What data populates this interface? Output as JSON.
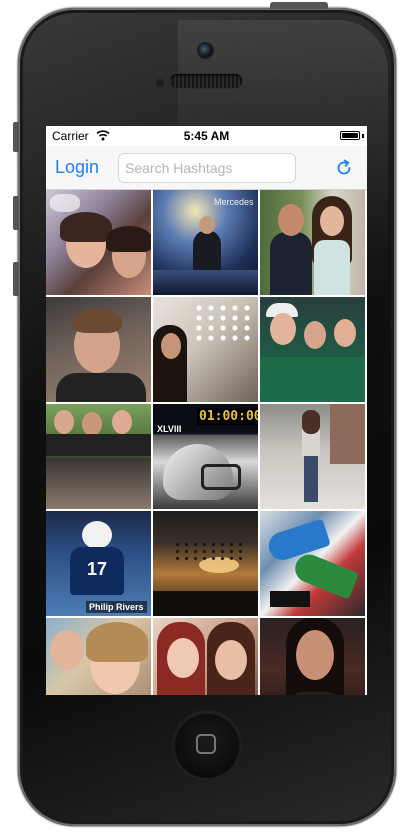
{
  "status_bar": {
    "carrier": "Carrier",
    "time": "5:45 AM",
    "wifi_icon": "wifi-icon",
    "battery_icon": "battery-icon",
    "battery_level": 1.0
  },
  "nav": {
    "login_label": "Login",
    "search_placeholder": "Search Hashtags",
    "search_value": "",
    "refresh_icon": "refresh-icon"
  },
  "colors": {
    "accent": "#1f7ff5",
    "navbar_bg": "#f7f7f8",
    "placeholder": "#b5b5ba"
  },
  "grid": {
    "columns": 3,
    "tiles": [
      {
        "subject": "party-selfie"
      },
      {
        "subject": "stage-performer",
        "text": "Mercedes"
      },
      {
        "subject": "couple-portrait"
      },
      {
        "subject": "boy-selfie"
      },
      {
        "subject": "girl-wall-lights"
      },
      {
        "subject": "friends-group"
      },
      {
        "subject": "guys-group"
      },
      {
        "subject": "countdown-football",
        "text": "01:00:00",
        "badge": "XLVIII"
      },
      {
        "subject": "girl-street"
      },
      {
        "subject": "football-player",
        "jersey": "17",
        "caption": "Philip Rivers"
      },
      {
        "subject": "sunset-birds"
      },
      {
        "subject": "graffiti-shoes"
      },
      {
        "subject": "girl-selfie-1"
      },
      {
        "subject": "two-girls-selfie"
      },
      {
        "subject": "girl-red-carpet"
      }
    ]
  },
  "device": {
    "home_button_icon": "home-button-icon"
  }
}
